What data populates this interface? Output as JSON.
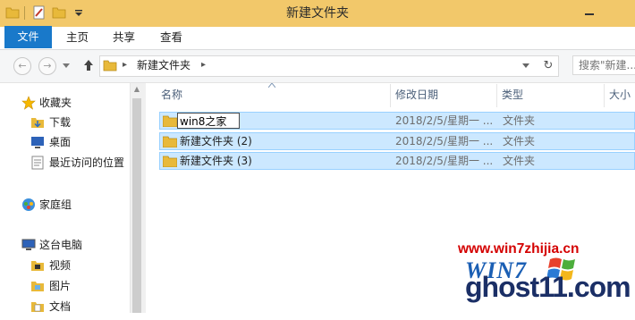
{
  "window": {
    "title": "新建文件夹"
  },
  "ribbon": {
    "tabs": [
      "文件",
      "主页",
      "共享",
      "查看"
    ]
  },
  "address": {
    "back_icon": "back-arrow-icon",
    "forward_icon": "forward-arrow-icon",
    "up_icon": "up-arrow-icon",
    "path": "新建文件夹",
    "refresh_icon": "refresh-icon",
    "search_placeholder": "搜索\"新建..."
  },
  "sidebar": {
    "items": [
      {
        "label": "收藏夹",
        "icon": "star-icon",
        "level": 0
      },
      {
        "label": "下载",
        "icon": "download-folder-icon",
        "level": 1
      },
      {
        "label": "桌面",
        "icon": "desktop-icon",
        "level": 1
      },
      {
        "label": "最近访问的位置",
        "icon": "recent-places-icon",
        "level": 1
      },
      {
        "label": "家庭组",
        "icon": "homegroup-icon",
        "level": 0
      },
      {
        "label": "这台电脑",
        "icon": "computer-icon",
        "level": 0
      },
      {
        "label": "视频",
        "icon": "videos-folder-icon",
        "level": 1
      },
      {
        "label": "图片",
        "icon": "pictures-folder-icon",
        "level": 1
      },
      {
        "label": "文档",
        "icon": "documents-folder-icon",
        "level": 1
      }
    ]
  },
  "columns": [
    "名称",
    "修改日期",
    "类型",
    "大小"
  ],
  "files": [
    {
      "name": "win8之家",
      "modified": "2018/2/5/星期一 ...",
      "type": "文件夹",
      "renaming": true
    },
    {
      "name": "新建文件夹 (2)",
      "modified": "2018/2/5/星期一 ...",
      "type": "文件夹"
    },
    {
      "name": "新建文件夹 (3)",
      "modified": "2018/2/5/星期一 ...",
      "type": "文件夹"
    }
  ],
  "watermark": {
    "url": "www.win7zhijia.cn",
    "logo_text": "WIN7",
    "site": "ghost11.com"
  },
  "colors": {
    "title_bar": "#f2c86a",
    "file_tab": "#1979ca",
    "selection": "#cce8ff",
    "selection_border": "#99d1ff"
  }
}
